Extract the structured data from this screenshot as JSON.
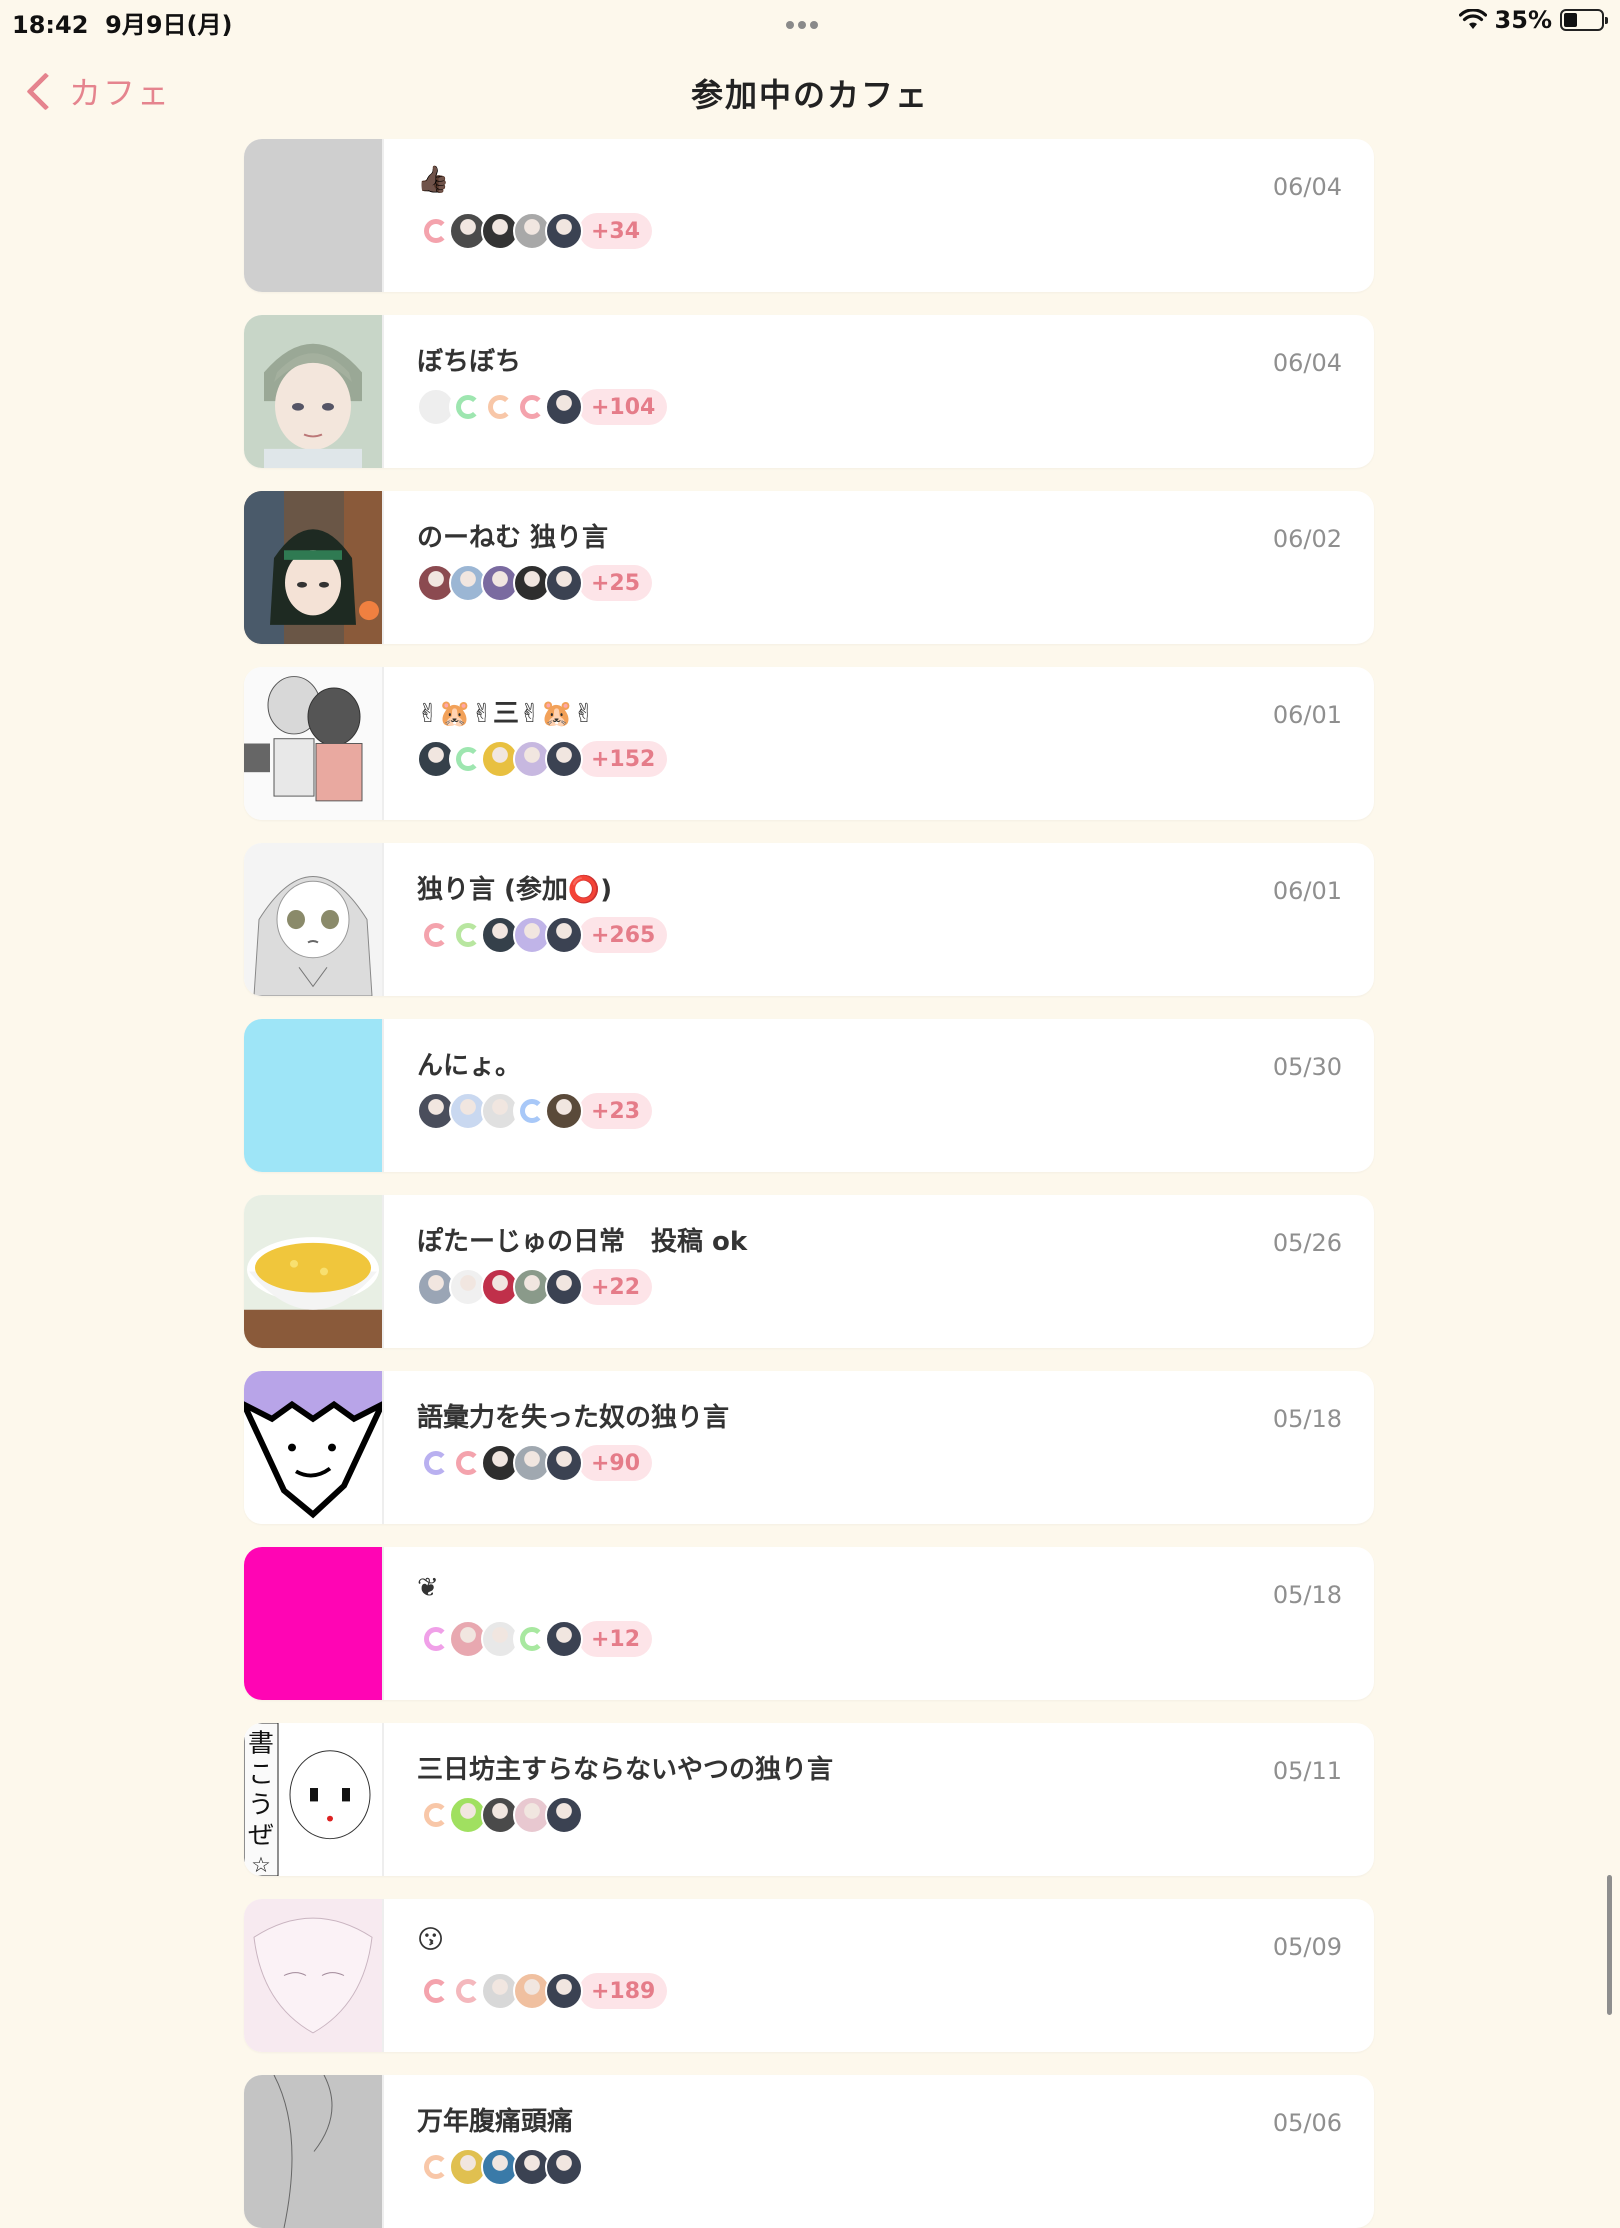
{
  "status_bar": {
    "time": "18:42",
    "date": "9月9日(月)",
    "battery": "35%",
    "battery_level": 0.35
  },
  "nav": {
    "back_label": "カフェ",
    "title": "参加中のカフェ"
  },
  "cafes": [
    {
      "title": "👍🏿",
      "date": "06/04",
      "count": "+34",
      "thumb": "gray",
      "avatars": [
        "ring:#f4a3ad",
        "img:#4b4b4b",
        "img:#333",
        "img:#a8a8a8",
        "img:#3b4252"
      ]
    },
    {
      "title": "ぼちぼち",
      "date": "06/04",
      "count": "+104",
      "thumb": "boy",
      "avatars": [
        "solid:#eeeeee",
        "ring:#9ee6b0",
        "ring:#f8c7a8",
        "ring:#f4a3ad",
        "img:#3b4252"
      ]
    },
    {
      "title": "のーねむ 独り言",
      "date": "06/02",
      "count": "+25",
      "thumb": "girl-dark",
      "avatars": [
        "img:#8b4a50",
        "img:#9bb6d4",
        "img:#7a6aa0",
        "img:#2e2e2e",
        "img:#3b4252"
      ]
    },
    {
      "title": "✌🐹✌三✌🐹✌",
      "date": "06/01",
      "count": "+152",
      "thumb": "couple",
      "avatars": [
        "img:#35404a",
        "ring:#9ee6b0",
        "img:#e8c040",
        "img:#c7b8e0",
        "img:#3b4252"
      ]
    },
    {
      "title": "独り言 (参加⭕️)",
      "date": "06/01",
      "count": "+265",
      "thumb": "girl-sketch",
      "avatars": [
        "ring:#f4a3ad",
        "ring:#b8e6a0",
        "img:#35404a",
        "img:#c0b4e8",
        "img:#3b4252"
      ]
    },
    {
      "title": "んにょ。",
      "date": "05/30",
      "count": "+23",
      "thumb": "cyan",
      "avatars": [
        "img:#4a4e5c",
        "img:#c9d8f0",
        "img:#e0e0e0",
        "ring:#a8c8f8",
        "img:#5a4a3a"
      ]
    },
    {
      "title": "ぽたーじゅの日常　投稿 ok",
      "date": "05/26",
      "count": "+22",
      "thumb": "soup",
      "avatars": [
        "img:#9aa5b5",
        "img:#f0f0f0",
        "img:#c0304a",
        "img:#8a9a8a",
        "img:#3b4252"
      ]
    },
    {
      "title": "語彙力を失った奴の独り言",
      "date": "05/18",
      "count": "+90",
      "thumb": "face",
      "avatars": [
        "ring:#b9b0f0",
        "ring:#f4a3ad",
        "img:#2e2e2e",
        "img:#a0a8b0",
        "img:#3b4252"
      ]
    },
    {
      "title": "❦",
      "date": "05/18",
      "count": "+12",
      "thumb": "magenta",
      "avatars": [
        "ring:#f0a0e8",
        "img:#e8a8b0",
        "img:#e8e8e8",
        "ring:#a8e8a0",
        "img:#3b4252"
      ]
    },
    {
      "title": "三日坊主すらならないやつの独り言",
      "date": "05/11",
      "count": "",
      "thumb": "manga",
      "avatars": [
        "ring:#f8c7a8",
        "img:#a0e060",
        "img:#4a4a4a",
        "img:#e8c8d0",
        "img:#3b4252"
      ]
    },
    {
      "title": "😗",
      "date": "05/09",
      "count": "+189",
      "thumb": "pink-sketch",
      "avatars": [
        "ring:#f4a3ad",
        "ring:#f4b8bd",
        "img:#d8d8d8",
        "img:#f0c0a0",
        "img:#3b4252"
      ]
    },
    {
      "title": "万年腹痛頭痛",
      "date": "05/06",
      "count": "",
      "thumb": "gray-sketch",
      "avatars": [
        "ring:#f8c7a8",
        "img:#e0c050",
        "img:#3a7aa8",
        "img:#3b4252",
        "img:#3b4252"
      ]
    }
  ]
}
